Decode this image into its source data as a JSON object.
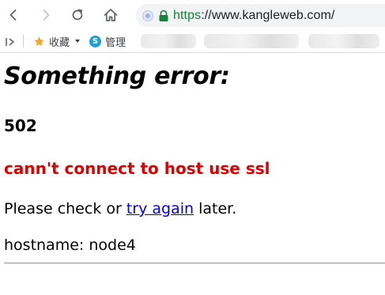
{
  "browser": {
    "url_scheme": "https",
    "url_rest": "://www.kangleweb.com/",
    "bookmarks": {
      "favorites_label": "收藏",
      "manage_label": "管理"
    }
  },
  "page": {
    "title": "Something error:",
    "code": "502",
    "message": "cann't connect to host use ssl",
    "hint_before": "Please check or ",
    "hint_link": "try again",
    "hint_after": " later.",
    "hostname_label": "hostname: ",
    "hostname_value": "node4"
  },
  "colors": {
    "error_red": "#e00000",
    "link_blue": "#0000ee",
    "secure_green": "#188038"
  }
}
